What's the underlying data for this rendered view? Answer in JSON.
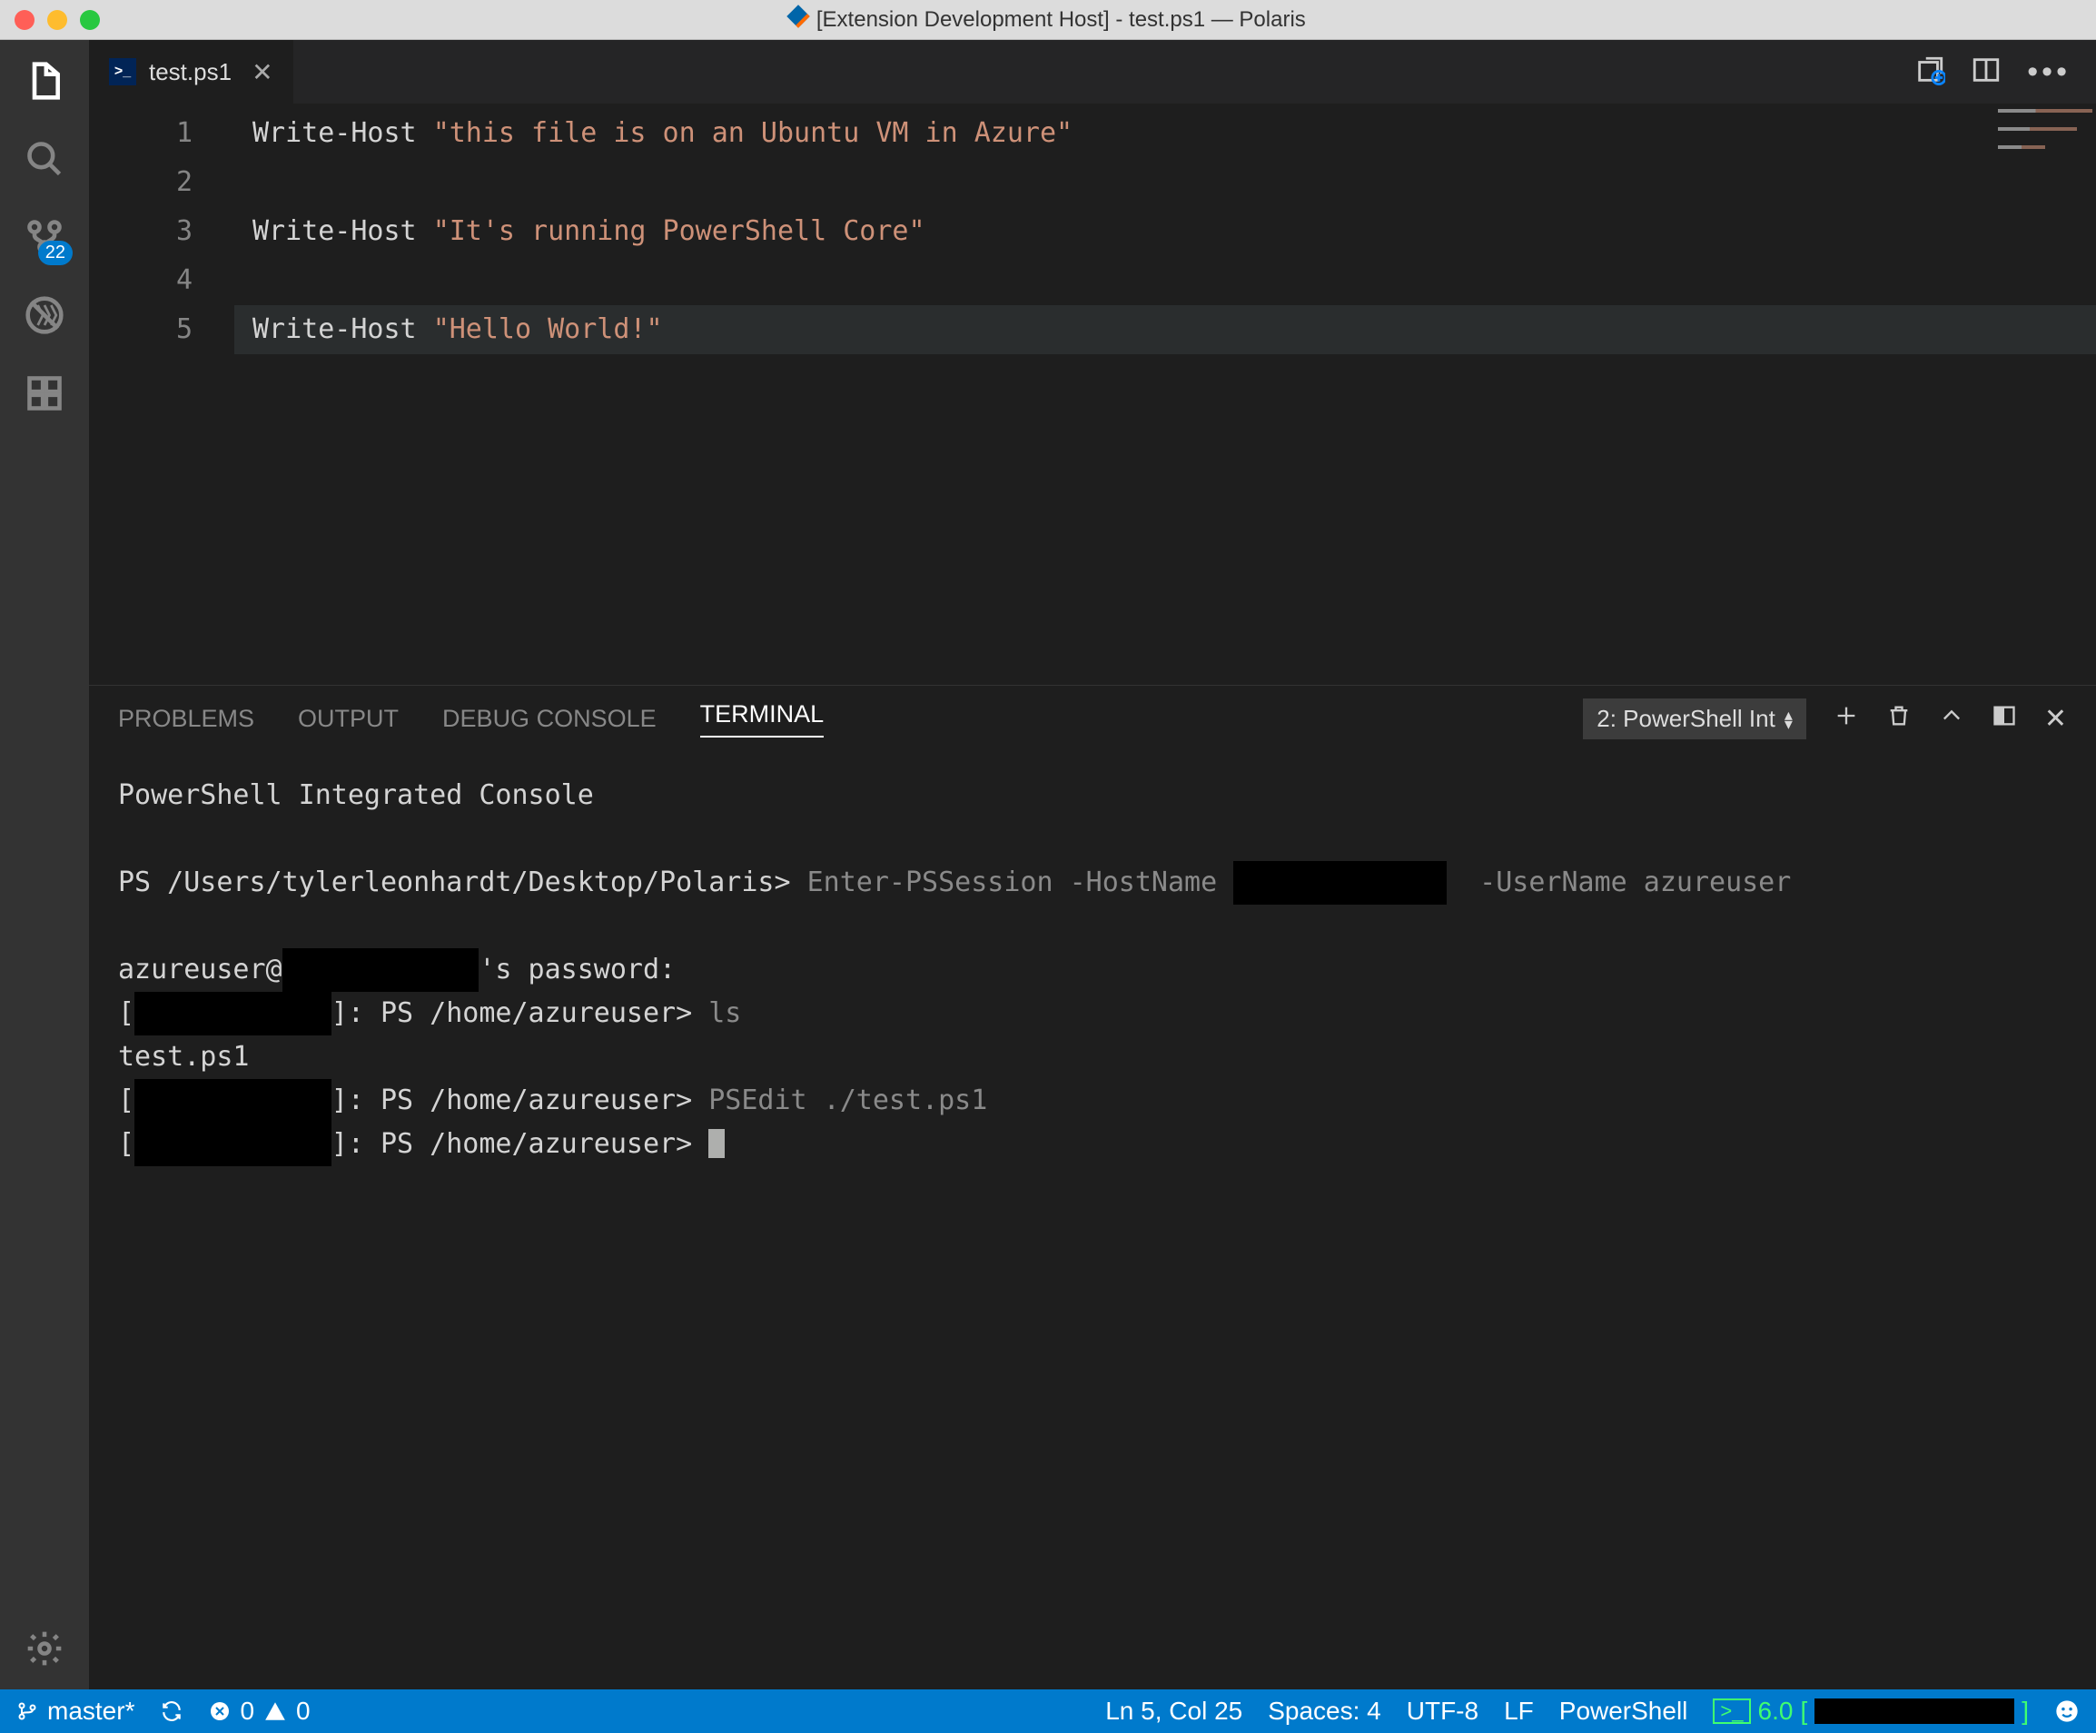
{
  "titlebar": {
    "title": "[Extension Development Host] - test.ps1 — Polaris"
  },
  "activitybar": {
    "scm_badge": "22"
  },
  "tabs": {
    "file": "test.ps1"
  },
  "editor": {
    "line_numbers": [
      "1",
      "2",
      "3",
      "4",
      "5"
    ],
    "lines": {
      "l1_cmd": "Write-Host ",
      "l1_str": "\"this file is on an Ubuntu VM in Azure\"",
      "l3_cmd": "Write-Host ",
      "l3_str": "\"It's running PowerShell Core\"",
      "l5_cmd": "Write-Host ",
      "l5_str": "\"Hello World!\""
    }
  },
  "panel": {
    "tabs": {
      "problems": "PROBLEMS",
      "output": "OUTPUT",
      "debug": "DEBUG CONSOLE",
      "terminal": "TERMINAL"
    },
    "selector": "2: PowerShell Int",
    "terminal": {
      "header": "PowerShell Integrated Console",
      "prompt1_ps": "PS /Users/tylerleonhardt/Desktop/Polaris> ",
      "prompt1_cmd_a": "Enter-PSSession -HostName ",
      "prompt1_cmd_b": " -UserName azureuser",
      "pw_a": "azureuser@",
      "pw_b": "'s password:",
      "line_ls_pre": "[",
      "line_ls_mid": "]: PS /home/azureuser> ",
      "line_ls_cmd": "ls",
      "ls_out": "test.ps1",
      "line_edit_cmd": "PSEdit ./test.ps1",
      "line_cursor_mid": "]: PS /home/azureuser> "
    }
  },
  "statusbar": {
    "branch": "master*",
    "err": "0",
    "warn": "0",
    "pos": "Ln 5, Col 25",
    "spaces": "Spaces: 4",
    "encoding": "UTF-8",
    "eol": "LF",
    "lang": "PowerShell",
    "psver": "6.0"
  }
}
